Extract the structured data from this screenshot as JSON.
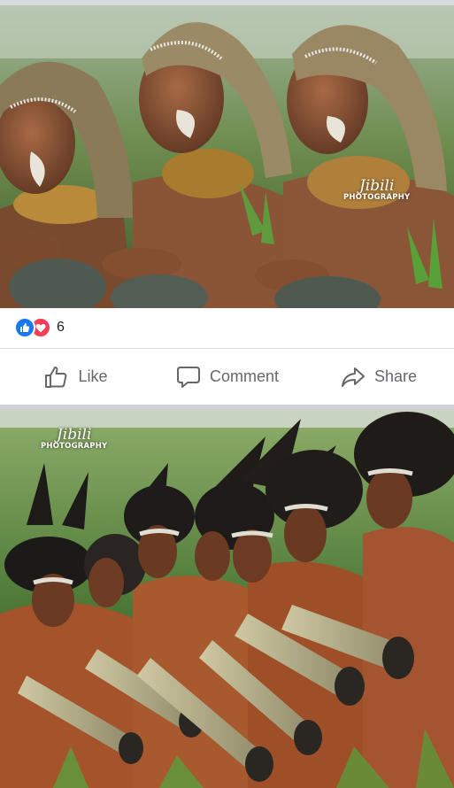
{
  "post": {
    "reaction_count": "6",
    "reaction_types": [
      "like",
      "love"
    ],
    "actions": {
      "like_label": "Like",
      "comment_label": "Comment",
      "share_label": "Share"
    }
  },
  "photos": [
    {
      "watermark_script": "Jibili",
      "watermark_caps": "PHOTOGRAPHY"
    },
    {
      "watermark_script": "Jibili",
      "watermark_caps": "PHOTOGRAPHY"
    }
  ],
  "colors": {
    "like_blue": "#1877f2",
    "love_red": "#f33e58",
    "action_gray": "#65676b"
  },
  "icons": {
    "like_reaction": "thumbs-up-icon",
    "love_reaction": "heart-icon",
    "like_action": "thumbs-up-outline-icon",
    "comment_action": "speech-bubble-icon",
    "share_action": "share-arrow-icon"
  }
}
